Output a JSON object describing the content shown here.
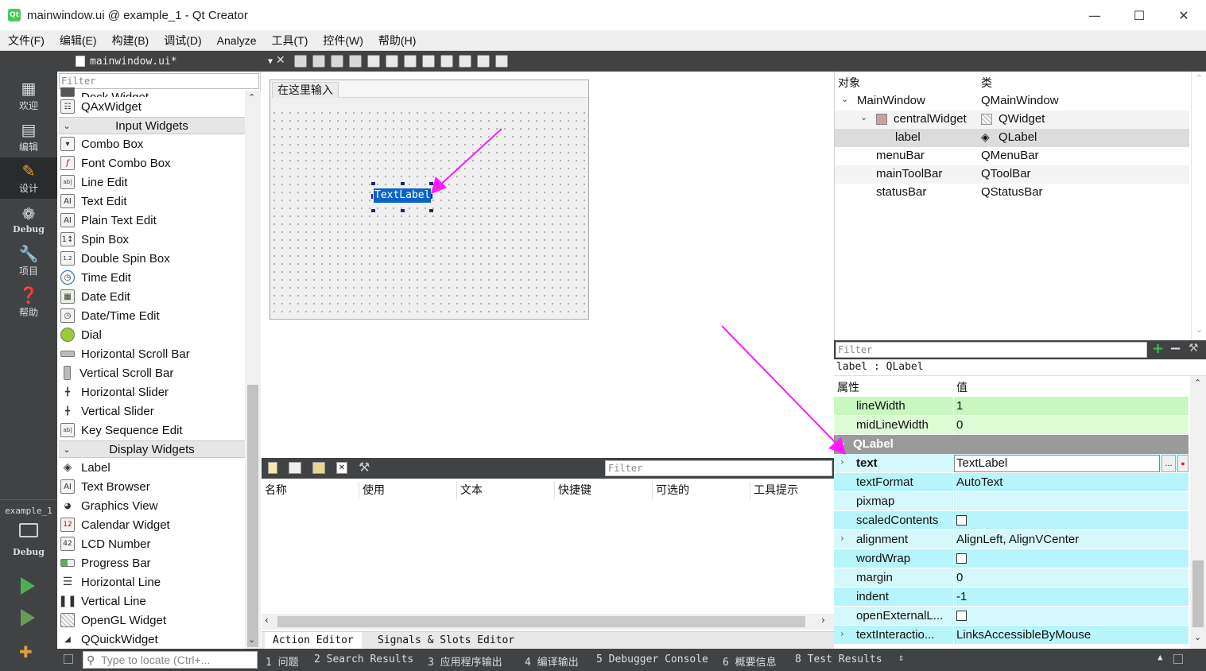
{
  "window": {
    "title": "mainwindow.ui @ example_1 - Qt Creator",
    "logo": "Qt"
  },
  "menubar": [
    "文件(F)",
    "编辑(E)",
    "构建(B)",
    "调试(D)",
    "Analyze",
    "工具(T)",
    "控件(W)",
    "帮助(H)"
  ],
  "modes": {
    "welcome": "欢迎",
    "edit": "编辑",
    "design": "设计",
    "debug": "Debug",
    "project": "项目",
    "help": "帮助",
    "target_project": "example_1",
    "target_mode": "Debug"
  },
  "editor": {
    "file_tab": "mainwindow.ui*"
  },
  "widgetbox": {
    "filter_placeholder": "Filter",
    "partial_top": "Dock Widget",
    "qax": "QAxWidget",
    "cat_input": "Input Widgets",
    "input": [
      "Combo Box",
      "Font Combo Box",
      "Line Edit",
      "Text Edit",
      "Plain Text Edit",
      "Spin Box",
      "Double Spin Box",
      "Time Edit",
      "Date Edit",
      "Date/Time Edit",
      "Dial",
      "Horizontal Scroll Bar",
      "Vertical Scroll Bar",
      "Horizontal Slider",
      "Vertical Slider",
      "Key Sequence Edit"
    ],
    "cat_display": "Display Widgets",
    "display": [
      "Label",
      "Text Browser",
      "Graphics View",
      "Calendar Widget",
      "LCD Number",
      "Progress Bar",
      "Horizontal Line",
      "Vertical Line",
      "OpenGL Widget",
      "QQuickWidget"
    ]
  },
  "form": {
    "menu_placeholder": "在这里输入",
    "label_text": "TextLabel"
  },
  "action_editor": {
    "filter_placeholder": "Filter",
    "columns": [
      "名称",
      "使用",
      "文本",
      "快捷键",
      "可选的",
      "工具提示"
    ],
    "tabs": [
      "Action Editor",
      "Signals & Slots Editor"
    ]
  },
  "object_inspector": {
    "headers": [
      "对象",
      "类"
    ],
    "rows": [
      {
        "name": "MainWindow",
        "cls": "QMainWindow"
      },
      {
        "name": "centralWidget",
        "cls": "QWidget"
      },
      {
        "name": "label",
        "cls": "QLabel"
      },
      {
        "name": "menuBar",
        "cls": "QMenuBar"
      },
      {
        "name": "mainToolBar",
        "cls": "QToolBar"
      },
      {
        "name": "statusBar",
        "cls": "QStatusBar"
      }
    ]
  },
  "property_editor": {
    "filter_placeholder": "Filter",
    "class_line": "label : QLabel",
    "headers": [
      "属性",
      "值"
    ],
    "lineWidth": {
      "name": "lineWidth",
      "value": "1"
    },
    "midLineWidth": {
      "name": "midLineWidth",
      "value": "0"
    },
    "group": "QLabel",
    "text": {
      "name": "text",
      "value": "TextLabel"
    },
    "textFormat": {
      "name": "textFormat",
      "value": "AutoText"
    },
    "pixmap": {
      "name": "pixmap",
      "value": ""
    },
    "scaledContents": {
      "name": "scaledContents"
    },
    "alignment": {
      "name": "alignment",
      "value": "AlignLeft, AlignVCenter"
    },
    "wordWrap": {
      "name": "wordWrap"
    },
    "margin": {
      "name": "margin",
      "value": "0"
    },
    "indent": {
      "name": "indent",
      "value": "-1"
    },
    "openExternal": {
      "name": "openExternalL..."
    },
    "textInteraction": {
      "name": "textInteractio...",
      "value": "LinksAccessibleByMouse"
    }
  },
  "statusbar": {
    "locator_placeholder": "Type to locate (Ctrl+...",
    "items": [
      "1 问题",
      "2 Search Results",
      "3 应用程序输出",
      "4 编译输出",
      "5 Debugger Console",
      "6 概要信息",
      "8 Test Results"
    ]
  },
  "colors": {
    "accent_arrow": "#ff1aff",
    "selection": "#0a64c8",
    "dark_panel": "#404244"
  }
}
